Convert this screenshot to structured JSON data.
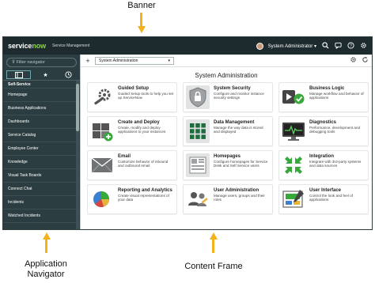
{
  "annotations": {
    "banner": "Banner",
    "application_navigator_line1": "Application",
    "application_navigator_line2": "Navigator",
    "content_frame": "Content Frame"
  },
  "header": {
    "logo_service": "service",
    "logo_now": "now",
    "subtitle": "Service Management",
    "user_name": "System Administrator",
    "caret": "▾",
    "icons": [
      "search-icon",
      "chat-icon",
      "help-icon",
      "gear-icon"
    ]
  },
  "navigator": {
    "filter_placeholder": "Filter navigator",
    "tabs": [
      "all-apps",
      "favorites",
      "history"
    ],
    "section": "Self-Service",
    "items": [
      "Homepage",
      "Business Applications",
      "Dashboards",
      "Service Catalog",
      "Employee Center",
      "Knowledge",
      "Visual Task Boards",
      "Connect Chat",
      "Incidents",
      "Watched Incidents"
    ]
  },
  "content": {
    "plus": "+",
    "app_selector": "System Administration",
    "caret": "▾",
    "page_title": "System Administration",
    "cards": [
      {
        "name": "Guided Setup",
        "desc": "Guided Setup tools to help you set up ServiceNow",
        "icon": "wrench-gear-icon"
      },
      {
        "name": "System Security",
        "desc": "Configure and monitor instance security settings",
        "icon": "shield-icon"
      },
      {
        "name": "Business Logic",
        "desc": "Manage workflow and behavior of applications",
        "icon": "play-check-icon"
      },
      {
        "name": "Create and Deploy",
        "desc": "Create, modify and deploy applications to your instances",
        "icon": "boxes-icon"
      },
      {
        "name": "Data Management",
        "desc": "Manage the way data is stored and displayed",
        "icon": "grid-icon"
      },
      {
        "name": "Diagnostics",
        "desc": "Performance, development and debugging tools",
        "icon": "monitor-icon"
      },
      {
        "name": "Email",
        "desc": "Customize behavior of inbound and outbound email",
        "icon": "envelope-icon"
      },
      {
        "name": "Homepages",
        "desc": "Configure homepages for Service Desk and Self Service users",
        "icon": "homepage-icon"
      },
      {
        "name": "Integration",
        "desc": "Integrate with 3rd-party systems and data sources",
        "icon": "arrows-in-icon"
      },
      {
        "name": "Reporting and Analytics",
        "desc": "Create visual representations of your data",
        "icon": "pie-chart-icon"
      },
      {
        "name": "User Administration",
        "desc": "Manage users, groups and their roles",
        "icon": "users-icon"
      },
      {
        "name": "User Interface",
        "desc": "Control the look and feel of applications",
        "icon": "paint-icon"
      }
    ]
  },
  "colors": {
    "accent_arrow": "#f3b21c",
    "header_bg": "#1e2b2e",
    "nav_bg": "#2b3d40",
    "brand_green": "#8cd24a"
  }
}
